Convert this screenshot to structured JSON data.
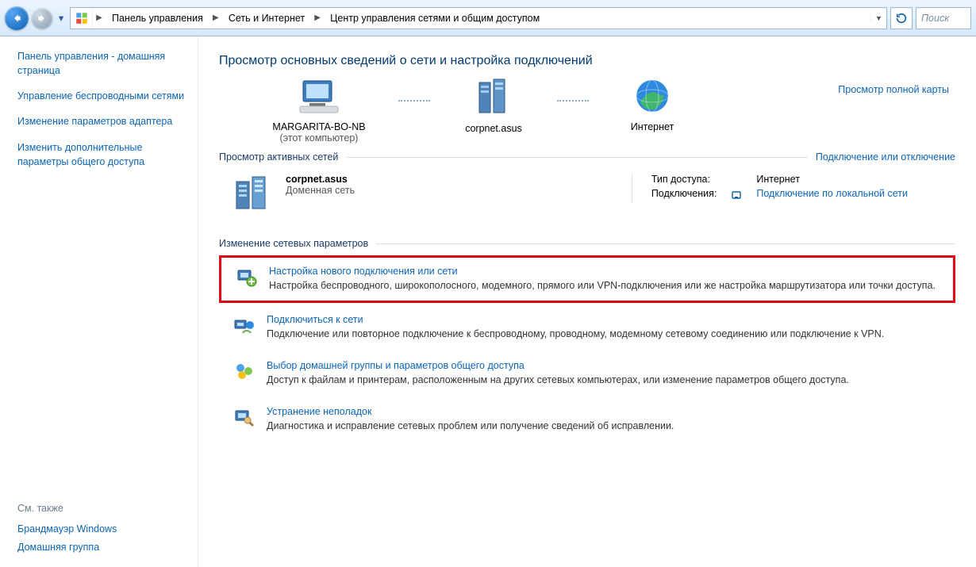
{
  "addressbar": {
    "items": [
      "Панель управления",
      "Сеть и Интернет",
      "Центр управления сетями и общим доступом"
    ]
  },
  "search": {
    "placeholder": "Поиск"
  },
  "sidebar": {
    "links": [
      "Панель управления - домашняя страница",
      "Управление беспроводными сетями",
      "Изменение параметров адаптера",
      "Изменить дополнительные параметры общего доступа"
    ],
    "footer_header": "См. также",
    "footer_links": [
      "Брандмауэр Windows",
      "Домашняя группа"
    ]
  },
  "page": {
    "title": "Просмотр основных сведений о сети и настройка подключений",
    "full_map_link": "Просмотр полной карты",
    "map_nodes": {
      "computer_name": "MARGARITA-BO-NB",
      "computer_sub": "(этот компьютер)",
      "network_name": "corpnet.asus",
      "internet_label": "Интернет"
    },
    "active_header": "Просмотр активных сетей",
    "active_action": "Подключение или отключение",
    "active_net": {
      "name": "corpnet.asus",
      "type": "Доменная сеть",
      "access_label": "Тип доступа:",
      "access_value": "Интернет",
      "conn_label": "Подключения:",
      "conn_value": "Подключение по локальной сети"
    },
    "change_header": "Изменение сетевых параметров",
    "tasks": [
      {
        "title": "Настройка нового подключения или сети",
        "desc": "Настройка беспроводного, широкополосного, модемного, прямого или VPN-подключения или же настройка маршрутизатора или точки доступа."
      },
      {
        "title": "Подключиться к сети",
        "desc": "Подключение или повторное подключение к беспроводному, проводному, модемному сетевому соединению или подключение к VPN."
      },
      {
        "title": "Выбор домашней группы и параметров общего доступа",
        "desc": "Доступ к файлам и принтерам, расположенным на других сетевых компьютерах, или изменение параметров общего доступа."
      },
      {
        "title": "Устранение неполадок",
        "desc": "Диагностика и исправление сетевых проблем или получение сведений об исправлении."
      }
    ]
  }
}
